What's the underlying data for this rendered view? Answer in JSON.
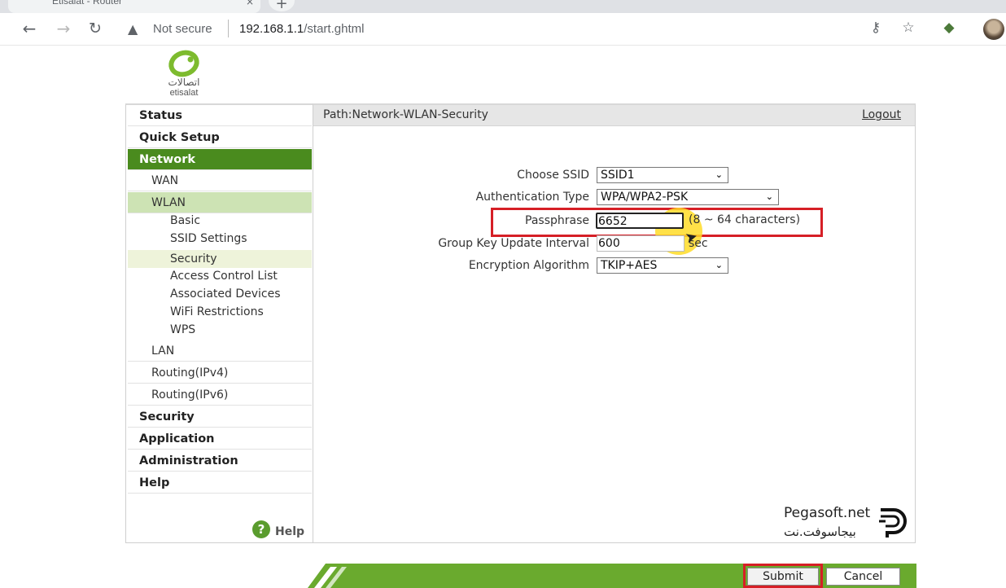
{
  "browser": {
    "tab_title": "Etisalat - Router",
    "tab_close": "×",
    "new_tab": "+",
    "not_secure": "Not secure",
    "url_host": "192.168.1.1",
    "url_path": "/start.ghtml"
  },
  "logo": {
    "arabic": "اتصالات",
    "english": "etisalat"
  },
  "sidebar": {
    "items": [
      {
        "label": "Status",
        "level": 1
      },
      {
        "label": "Quick Setup",
        "level": 1
      },
      {
        "label": "Network",
        "level": 1,
        "active": true
      },
      {
        "label": "WAN",
        "level": 2
      },
      {
        "label": "WLAN",
        "level": 2,
        "active": true
      },
      {
        "label": "Basic",
        "level": 3
      },
      {
        "label": "SSID Settings",
        "level": 3
      },
      {
        "label": "Security",
        "level": 3,
        "active": true
      },
      {
        "label": "Access Control List",
        "level": 3
      },
      {
        "label": "Associated Devices",
        "level": 3
      },
      {
        "label": "WiFi Restrictions",
        "level": 3
      },
      {
        "label": "WPS",
        "level": 3
      },
      {
        "label": "LAN",
        "level": 2
      },
      {
        "label": "Routing(IPv4)",
        "level": 2
      },
      {
        "label": "Routing(IPv6)",
        "level": 2
      },
      {
        "label": "Security",
        "level": 1
      },
      {
        "label": "Application",
        "level": 1
      },
      {
        "label": "Administration",
        "level": 1
      },
      {
        "label": "Help",
        "level": 1
      }
    ],
    "help_label": "Help",
    "help_glyph": "?"
  },
  "main": {
    "path": "Path:Network-WLAN-Security",
    "logout": "Logout",
    "form": {
      "ssid_label": "Choose SSID",
      "ssid_value": "SSID1",
      "auth_label": "Authentication Type",
      "auth_value": "WPA/WPA2-PSK",
      "pass_label": "Passphrase",
      "pass_value": "6652",
      "pass_hint": "(8 ~ 64 characters)",
      "gkui_label": "Group Key Update Interval",
      "gkui_value": "600",
      "gkui_unit": "sec",
      "enc_label": "Encryption Algorithm",
      "enc_value": "TKIP+AES"
    },
    "submit": "Submit",
    "cancel": "Cancel"
  },
  "watermark": {
    "en": "Pegasoft.net",
    "ar": "بيجاسوفت.نت"
  },
  "colors": {
    "accent_green": "#4a8b1e",
    "highlight_red": "#d61f26"
  }
}
